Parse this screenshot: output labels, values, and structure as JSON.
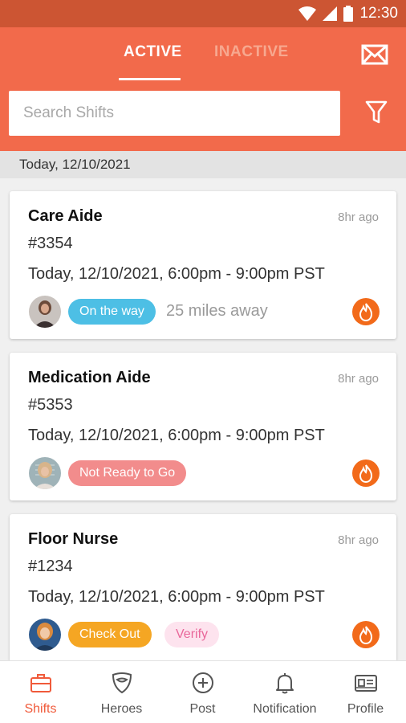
{
  "status_bar": {
    "time": "12:30"
  },
  "header": {
    "tabs": [
      {
        "label": "ACTIVE"
      },
      {
        "label": "INACTIVE"
      }
    ],
    "search": {
      "placeholder": "Search Shifts"
    }
  },
  "date_header": "Today, 12/10/2021",
  "shifts": [
    {
      "title": "Care Aide",
      "ago": "8hr ago",
      "id": "#3354",
      "time": "Today, 12/10/2021, 6:00pm - 9:00pm PST",
      "status": "On the way",
      "distance": "25 miles away"
    },
    {
      "title": "Medication Aide",
      "ago": "8hr ago",
      "id": "#5353",
      "time": "Today, 12/10/2021, 6:00pm - 9:00pm PST",
      "status": "Not Ready to Go"
    },
    {
      "title": "Floor Nurse",
      "ago": "8hr ago",
      "id": "#1234",
      "time": "Today, 12/10/2021, 6:00pm - 9:00pm PST",
      "status": "Check Out",
      "status2": "Verify"
    }
  ],
  "colors": {
    "brand": "#f26a4b",
    "on_the_way": "#4dbfe5",
    "not_ready": "#f28c8c",
    "check_out": "#f5a623",
    "verify_bg": "#fde3ee",
    "verify_text": "#e9679a",
    "fire": "#f26a1a"
  },
  "bottom_nav": [
    {
      "label": "Shifts",
      "icon": "briefcase-icon"
    },
    {
      "label": "Heroes",
      "icon": "shield-icon"
    },
    {
      "label": "Post",
      "icon": "plus-circle-icon"
    },
    {
      "label": "Notification",
      "icon": "bell-icon"
    },
    {
      "label": "Profile",
      "icon": "id-card-icon"
    }
  ]
}
